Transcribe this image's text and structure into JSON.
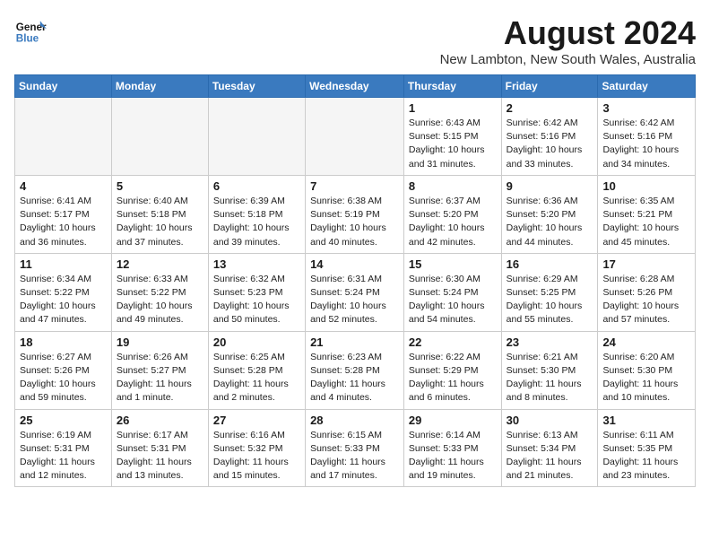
{
  "header": {
    "logo_line1": "General",
    "logo_line2": "Blue",
    "month_title": "August 2024",
    "location": "New Lambton, New South Wales, Australia"
  },
  "weekdays": [
    "Sunday",
    "Monday",
    "Tuesday",
    "Wednesday",
    "Thursday",
    "Friday",
    "Saturday"
  ],
  "weeks": [
    [
      {
        "day": "",
        "text": ""
      },
      {
        "day": "",
        "text": ""
      },
      {
        "day": "",
        "text": ""
      },
      {
        "day": "",
        "text": ""
      },
      {
        "day": "1",
        "text": "Sunrise: 6:43 AM\nSunset: 5:15 PM\nDaylight: 10 hours\nand 31 minutes."
      },
      {
        "day": "2",
        "text": "Sunrise: 6:42 AM\nSunset: 5:16 PM\nDaylight: 10 hours\nand 33 minutes."
      },
      {
        "day": "3",
        "text": "Sunrise: 6:42 AM\nSunset: 5:16 PM\nDaylight: 10 hours\nand 34 minutes."
      }
    ],
    [
      {
        "day": "4",
        "text": "Sunrise: 6:41 AM\nSunset: 5:17 PM\nDaylight: 10 hours\nand 36 minutes."
      },
      {
        "day": "5",
        "text": "Sunrise: 6:40 AM\nSunset: 5:18 PM\nDaylight: 10 hours\nand 37 minutes."
      },
      {
        "day": "6",
        "text": "Sunrise: 6:39 AM\nSunset: 5:18 PM\nDaylight: 10 hours\nand 39 minutes."
      },
      {
        "day": "7",
        "text": "Sunrise: 6:38 AM\nSunset: 5:19 PM\nDaylight: 10 hours\nand 40 minutes."
      },
      {
        "day": "8",
        "text": "Sunrise: 6:37 AM\nSunset: 5:20 PM\nDaylight: 10 hours\nand 42 minutes."
      },
      {
        "day": "9",
        "text": "Sunrise: 6:36 AM\nSunset: 5:20 PM\nDaylight: 10 hours\nand 44 minutes."
      },
      {
        "day": "10",
        "text": "Sunrise: 6:35 AM\nSunset: 5:21 PM\nDaylight: 10 hours\nand 45 minutes."
      }
    ],
    [
      {
        "day": "11",
        "text": "Sunrise: 6:34 AM\nSunset: 5:22 PM\nDaylight: 10 hours\nand 47 minutes."
      },
      {
        "day": "12",
        "text": "Sunrise: 6:33 AM\nSunset: 5:22 PM\nDaylight: 10 hours\nand 49 minutes."
      },
      {
        "day": "13",
        "text": "Sunrise: 6:32 AM\nSunset: 5:23 PM\nDaylight: 10 hours\nand 50 minutes."
      },
      {
        "day": "14",
        "text": "Sunrise: 6:31 AM\nSunset: 5:24 PM\nDaylight: 10 hours\nand 52 minutes."
      },
      {
        "day": "15",
        "text": "Sunrise: 6:30 AM\nSunset: 5:24 PM\nDaylight: 10 hours\nand 54 minutes."
      },
      {
        "day": "16",
        "text": "Sunrise: 6:29 AM\nSunset: 5:25 PM\nDaylight: 10 hours\nand 55 minutes."
      },
      {
        "day": "17",
        "text": "Sunrise: 6:28 AM\nSunset: 5:26 PM\nDaylight: 10 hours\nand 57 minutes."
      }
    ],
    [
      {
        "day": "18",
        "text": "Sunrise: 6:27 AM\nSunset: 5:26 PM\nDaylight: 10 hours\nand 59 minutes."
      },
      {
        "day": "19",
        "text": "Sunrise: 6:26 AM\nSunset: 5:27 PM\nDaylight: 11 hours\nand 1 minute."
      },
      {
        "day": "20",
        "text": "Sunrise: 6:25 AM\nSunset: 5:28 PM\nDaylight: 11 hours\nand 2 minutes."
      },
      {
        "day": "21",
        "text": "Sunrise: 6:23 AM\nSunset: 5:28 PM\nDaylight: 11 hours\nand 4 minutes."
      },
      {
        "day": "22",
        "text": "Sunrise: 6:22 AM\nSunset: 5:29 PM\nDaylight: 11 hours\nand 6 minutes."
      },
      {
        "day": "23",
        "text": "Sunrise: 6:21 AM\nSunset: 5:30 PM\nDaylight: 11 hours\nand 8 minutes."
      },
      {
        "day": "24",
        "text": "Sunrise: 6:20 AM\nSunset: 5:30 PM\nDaylight: 11 hours\nand 10 minutes."
      }
    ],
    [
      {
        "day": "25",
        "text": "Sunrise: 6:19 AM\nSunset: 5:31 PM\nDaylight: 11 hours\nand 12 minutes."
      },
      {
        "day": "26",
        "text": "Sunrise: 6:17 AM\nSunset: 5:31 PM\nDaylight: 11 hours\nand 13 minutes."
      },
      {
        "day": "27",
        "text": "Sunrise: 6:16 AM\nSunset: 5:32 PM\nDaylight: 11 hours\nand 15 minutes."
      },
      {
        "day": "28",
        "text": "Sunrise: 6:15 AM\nSunset: 5:33 PM\nDaylight: 11 hours\nand 17 minutes."
      },
      {
        "day": "29",
        "text": "Sunrise: 6:14 AM\nSunset: 5:33 PM\nDaylight: 11 hours\nand 19 minutes."
      },
      {
        "day": "30",
        "text": "Sunrise: 6:13 AM\nSunset: 5:34 PM\nDaylight: 11 hours\nand 21 minutes."
      },
      {
        "day": "31",
        "text": "Sunrise: 6:11 AM\nSunset: 5:35 PM\nDaylight: 11 hours\nand 23 minutes."
      }
    ]
  ]
}
